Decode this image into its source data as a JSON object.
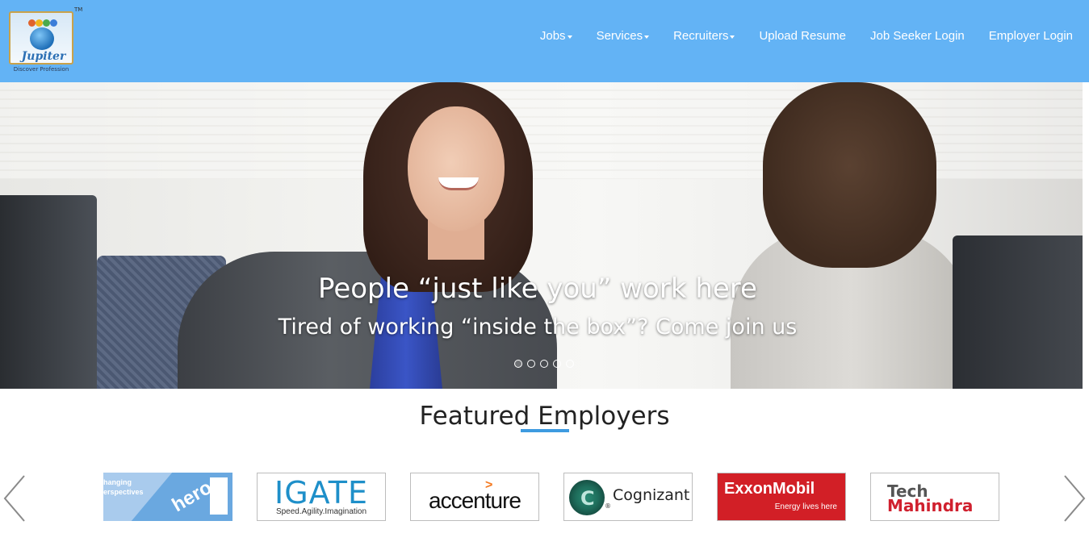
{
  "brand": {
    "logo_name": "Jupiter",
    "tagline": "Discover Profession",
    "trademark": "TM",
    "colors": {
      "header_bg": "#63b3f5",
      "accent": "#3e9be0"
    }
  },
  "nav": {
    "items": [
      {
        "label": "Jobs",
        "dropdown": true
      },
      {
        "label": "Services",
        "dropdown": true
      },
      {
        "label": "Recruiters",
        "dropdown": true
      },
      {
        "label": "Upload Resume",
        "dropdown": false
      },
      {
        "label": "Job Seeker Login",
        "dropdown": false
      },
      {
        "label": "Employer Login",
        "dropdown": false
      }
    ]
  },
  "hero": {
    "title": "People “just like you” work here",
    "subtitle": "Tired of working “inside the box”? Come join us",
    "slides_total": 5,
    "active_slide": 1
  },
  "featured": {
    "title": "Featured Employers",
    "prev_icon": "chevron-left-icon",
    "next_icon": "chevron-right-icon",
    "employers": [
      {
        "name": "hero",
        "tagline_1": "hanging",
        "tagline_2": "erspectives"
      },
      {
        "name": "IGATE",
        "tagline": "Speed.Agility.Imagination"
      },
      {
        "name": "accenture",
        "mark": ">"
      },
      {
        "name": "Cognizant",
        "mark": "C",
        "reg": "®"
      },
      {
        "name": "ExxonMobil",
        "tagline": "Energy lives here"
      },
      {
        "name_1": "Tech",
        "name_2": "Mahindra"
      }
    ]
  }
}
